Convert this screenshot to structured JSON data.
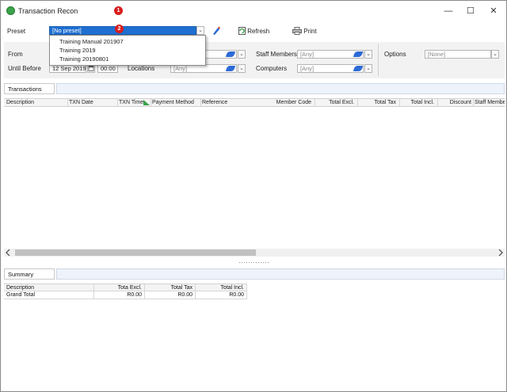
{
  "window": {
    "title": "Transaction Recon",
    "controls": {
      "minimize": "—",
      "maximize": "☐",
      "close": "✕"
    }
  },
  "badges": [
    "1",
    "2"
  ],
  "preset": {
    "label": "Preset",
    "value": "[No preset]",
    "options": [
      "Training Manual 201907",
      "Training 2019",
      "Training 20190801"
    ]
  },
  "toolbar": {
    "refresh_label": "Refresh",
    "print_label": "Print"
  },
  "filters": {
    "from_label": "From",
    "until_label": "Until Before",
    "until_date": "12 Sep 2019",
    "until_time": "00:00",
    "locations_label": "Locations",
    "locations_value": "[Any]",
    "staff_label": "Staff Members",
    "staff_value": "[Any]",
    "computers_label": "Computers",
    "computers_value": "[Any]",
    "options_label": "Options",
    "options_value": "[None]"
  },
  "transactions": {
    "section_label": "Transactions",
    "columns": [
      "Description",
      "TXN Date",
      "TXN Time",
      "Payment Method",
      "Reference",
      "Member Code",
      "Total Excl.",
      "Total Tax",
      "Total Incl.",
      "Discount",
      "Staff Member"
    ]
  },
  "summary": {
    "section_label": "Summary",
    "columns": [
      "Description",
      "Tota Excl.",
      "Total Tax",
      "Total Incl."
    ],
    "rows": [
      {
        "description": "Grand Total",
        "excl": "R0.00",
        "tax": "R0.00",
        "incl": "R0.00"
      }
    ]
  },
  "colors": {
    "accent": "#1f6fd1",
    "badge": "#d81d1d",
    "panel": "#f2f2f2"
  }
}
